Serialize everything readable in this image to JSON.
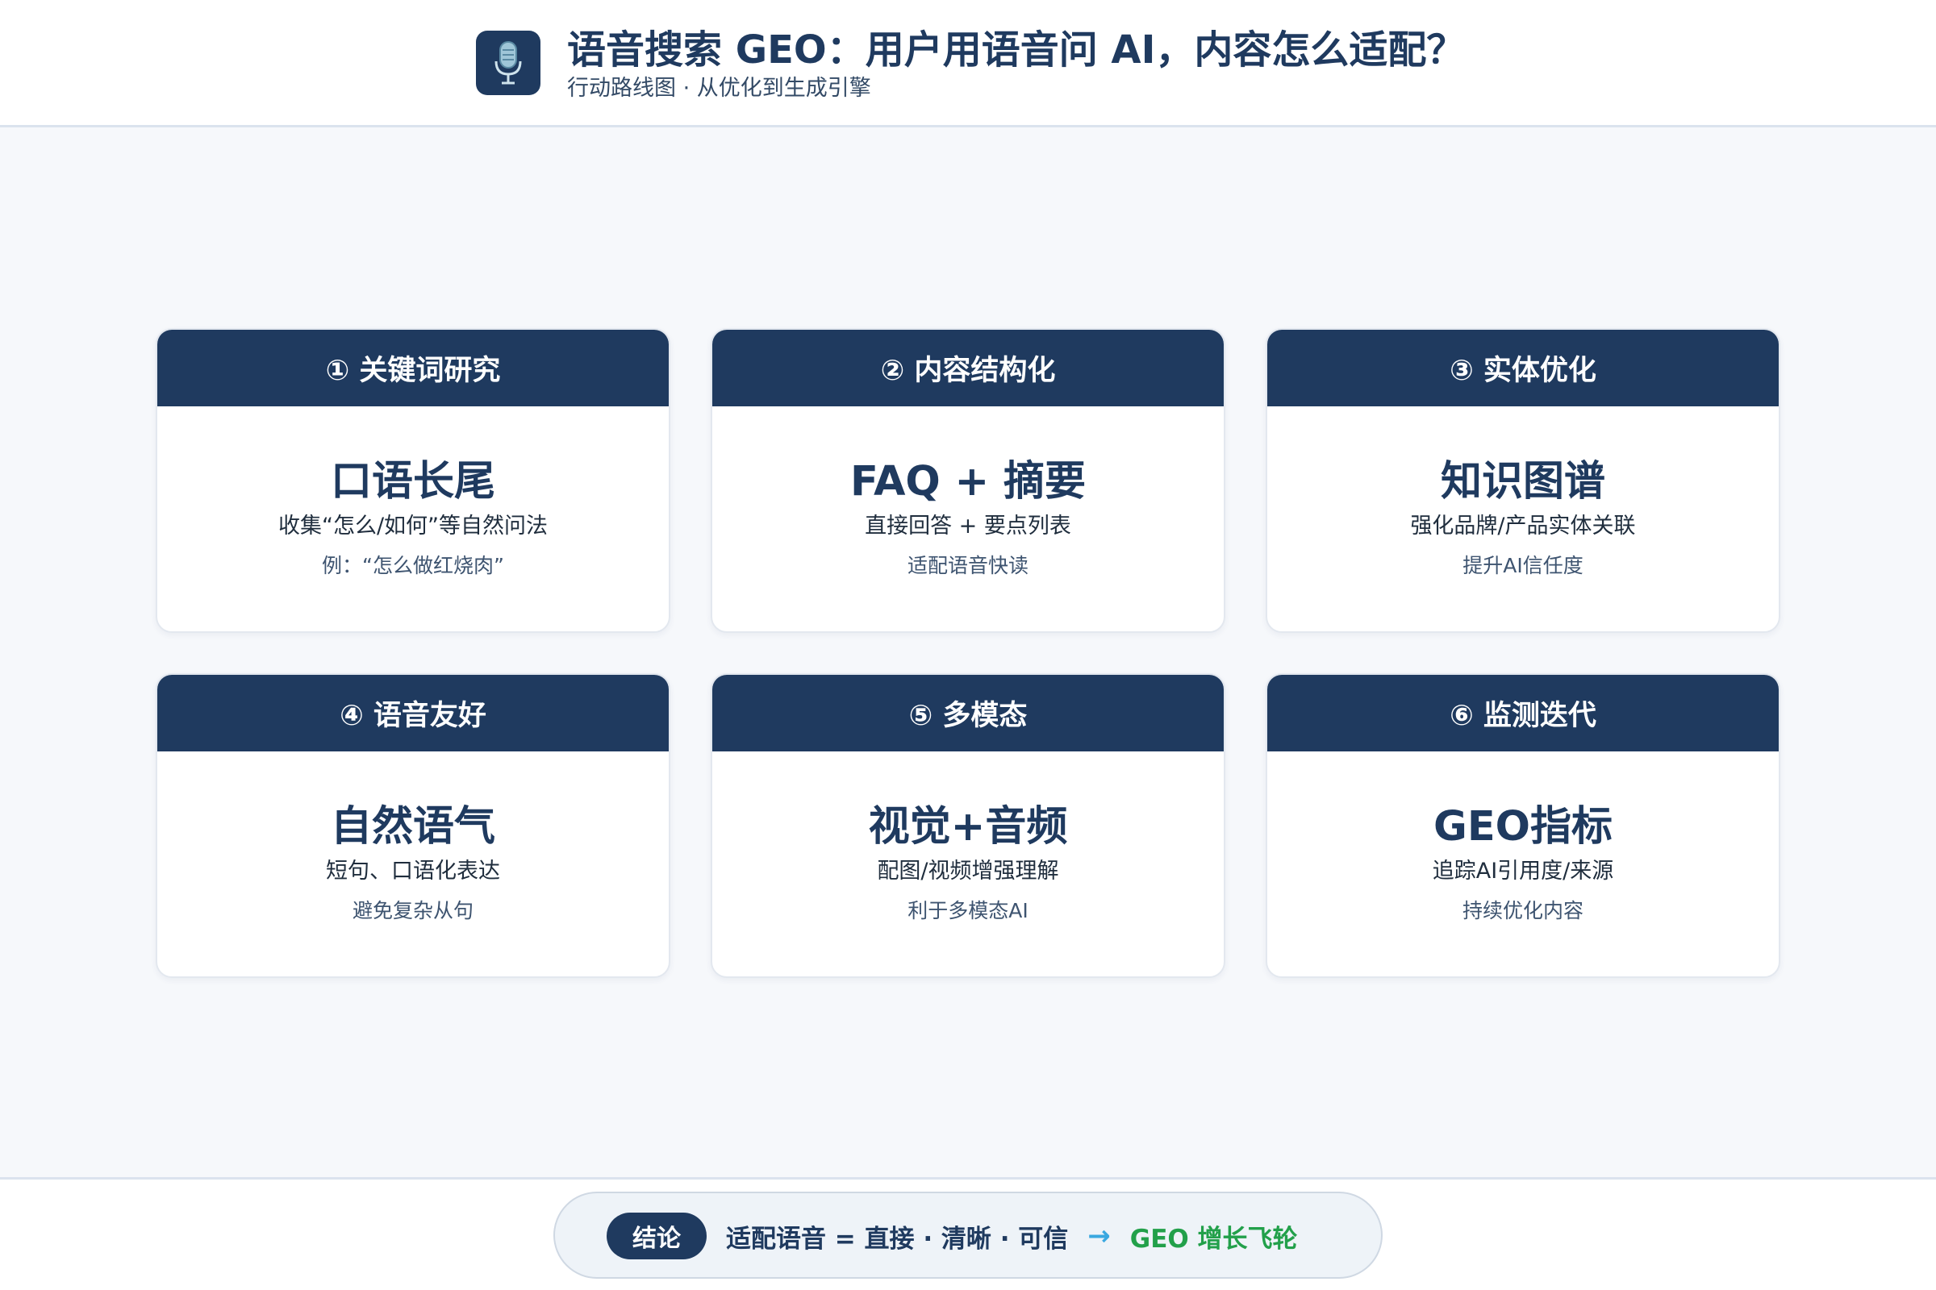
{
  "header": {
    "logo_icon": "microphone-icon",
    "title": "语音搜索 GEO：用户用语音问 AI，内容怎么适配？",
    "subtitle": "行动路线图 · 从优化到生成引擎"
  },
  "cards": [
    {
      "head": "① 关键词研究",
      "main": "口语长尾",
      "desc": "收集“怎么/如何”等自然问法",
      "note": "例：“怎么做红烧肉”"
    },
    {
      "head": "② 内容结构化",
      "main": "FAQ + 摘要",
      "desc": "直接回答 + 要点列表",
      "note": "适配语音快读"
    },
    {
      "head": "③ 实体优化",
      "main": "知识图谱",
      "desc": "强化品牌/产品实体关联",
      "note": "提升AI信任度"
    },
    {
      "head": "④ 语音友好",
      "main": "自然语气",
      "desc": "短句、口语化表达",
      "note": "避免复杂从句"
    },
    {
      "head": "⑤ 多模态",
      "main": "视觉+音频",
      "desc": "配图/视频增强理解",
      "note": "利于多模态AI"
    },
    {
      "head": "⑥ 监测迭代",
      "main": "GEO指标",
      "desc": "追踪AI引用度/来源",
      "note": "持续优化内容"
    }
  ],
  "footer": {
    "badge": "结论",
    "conclusion": "适配语音 = 直接 · 清晰 · 可信",
    "arrow": "→",
    "result": "GEO 增长飞轮"
  },
  "colors": {
    "primary": "#1f3a5f",
    "background": "#f6f8fb",
    "arrow": "#3aa8e0",
    "result": "#22a04a"
  }
}
